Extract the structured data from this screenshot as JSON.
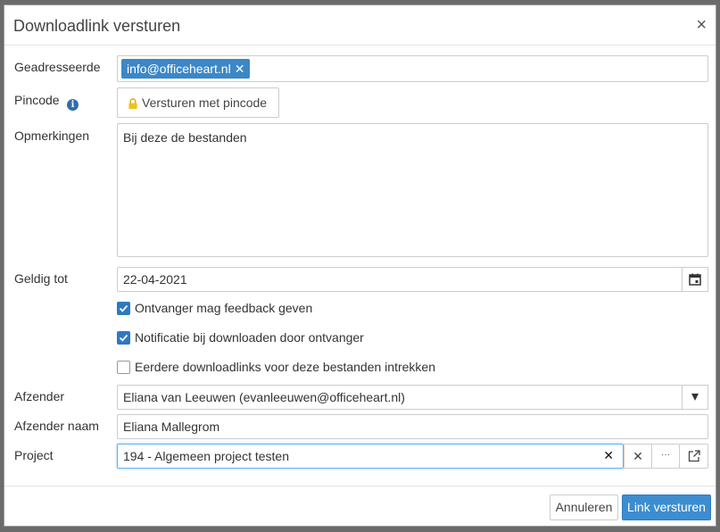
{
  "dialog": {
    "title": "Downloadlink versturen",
    "close_glyph": "×"
  },
  "form": {
    "recipient": {
      "label": "Geadresseerde",
      "tags": [
        "info@officeheart.nl"
      ],
      "tag_remove_glyph": "✕"
    },
    "pincode": {
      "label": "Pincode",
      "info_glyph": "i",
      "button_label": "Versturen met pincode"
    },
    "remarks": {
      "label": "Opmerkingen",
      "value": "Bij deze de bestanden"
    },
    "valid_until": {
      "label": "Geldig tot",
      "value": "22-04-2021"
    },
    "checkboxes": [
      {
        "label": "Ontvanger mag feedback geven",
        "checked": true
      },
      {
        "label": "Notificatie bij downloaden door ontvanger",
        "checked": true
      },
      {
        "label": "Eerdere downloadlinks voor deze bestanden intrekken",
        "checked": false
      }
    ],
    "sender": {
      "label": "Afzender",
      "value": "Eliana van Leeuwen (evanleeuwen@officeheart.nl)",
      "dropdown_glyph": "▾"
    },
    "sender_name": {
      "label": "Afzender naam",
      "value": "Eliana Mallegrom"
    },
    "project": {
      "label": "Project",
      "value": "194 - Algemeen project testen",
      "clear_glyph": "✕",
      "addon_clear_glyph": "✕",
      "addon_more_glyph": "···"
    }
  },
  "footer": {
    "cancel_label": "Annuleren",
    "submit_label": "Link versturen"
  },
  "colors": {
    "accent": "#3c8dd1",
    "tag": "#3c87c6",
    "lock": "#f2c01e"
  }
}
